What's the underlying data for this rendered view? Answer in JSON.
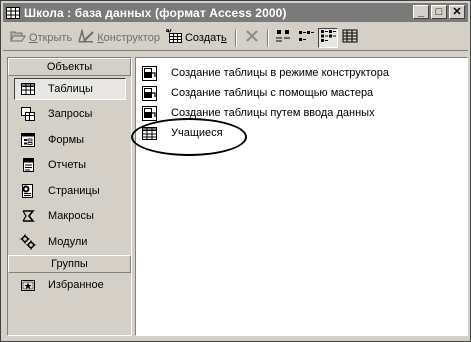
{
  "window": {
    "title": "Школа : база данных (формат Access 2000)",
    "controls": {
      "minimize": "_",
      "maximize": "□",
      "close": "✕"
    }
  },
  "toolbar": {
    "open_label": "Открыть",
    "open_underline": "О",
    "design_label": "Конструктор",
    "design_underline": "К",
    "create_label": "Создать",
    "create_underline": "ь"
  },
  "sidebar": {
    "objects_header": "Объекты",
    "items": [
      {
        "label": "Таблицы",
        "icon": "table-icon",
        "selected": true
      },
      {
        "label": "Запросы",
        "icon": "query-icon"
      },
      {
        "label": "Формы",
        "icon": "form-icon"
      },
      {
        "label": "Отчеты",
        "icon": "report-icon"
      },
      {
        "label": "Страницы",
        "icon": "page-icon"
      },
      {
        "label": "Макросы",
        "icon": "macro-icon"
      },
      {
        "label": "Модули",
        "icon": "module-icon"
      }
    ],
    "groups_header": "Группы",
    "groups": [
      {
        "label": "Избранное",
        "icon": "favorites-icon"
      }
    ]
  },
  "list": {
    "items": [
      {
        "label": "Создание таблицы в режиме конструктора",
        "icon": "shortcut-icon"
      },
      {
        "label": "Создание таблицы с помощью мастера",
        "icon": "shortcut-icon"
      },
      {
        "label": "Создание таблицы путем ввода данных",
        "icon": "shortcut-icon"
      },
      {
        "label": "Учащиеся",
        "icon": "table-icon",
        "circled": true
      }
    ]
  }
}
